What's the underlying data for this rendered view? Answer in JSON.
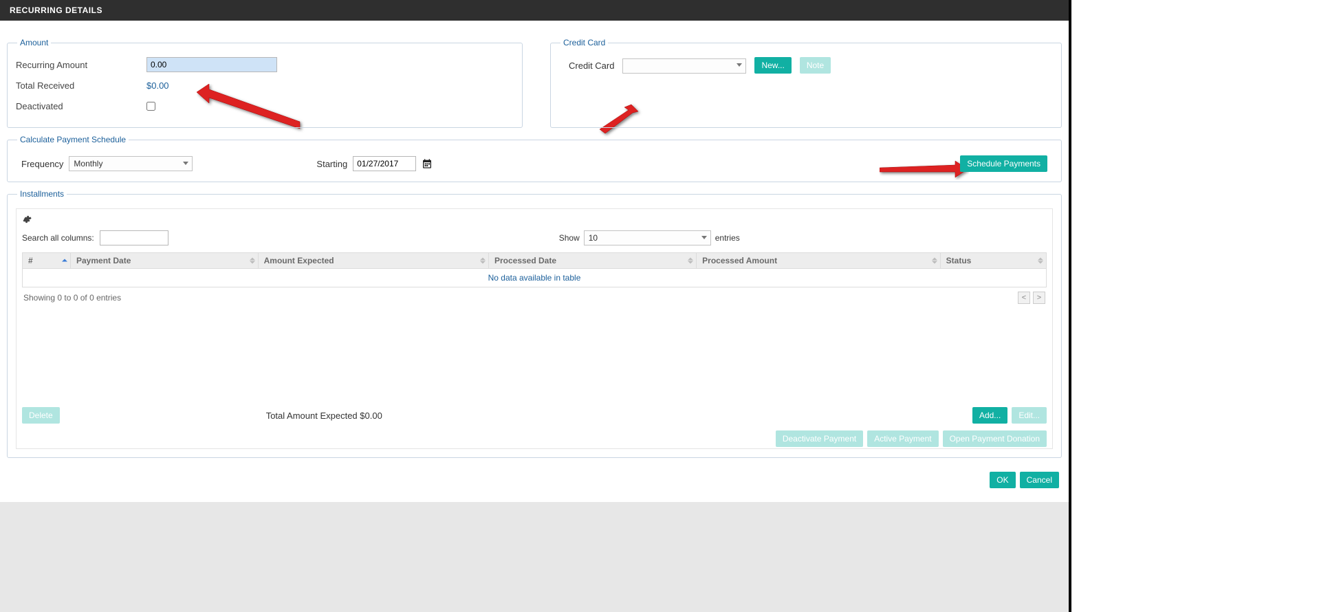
{
  "header": {
    "title": "RECURRING DETAILS"
  },
  "amount_section": {
    "legend": "Amount",
    "recurring_amount_label": "Recurring Amount",
    "recurring_amount_value": "0.00",
    "total_received_label": "Total Received",
    "total_received_value": "$0.00",
    "deactivated_label": "Deactivated",
    "deactivated_checked": false
  },
  "credit_card_section": {
    "legend": "Credit Card",
    "label": "Credit Card",
    "selected": "",
    "new_button": "New...",
    "note_button": "Note"
  },
  "schedule_section": {
    "legend": "Calculate Payment Schedule",
    "frequency_label": "Frequency",
    "frequency_value": "Monthly",
    "starting_label": "Starting",
    "starting_value": "01/27/2017",
    "schedule_button": "Schedule Payments"
  },
  "installments_section": {
    "legend": "Installments",
    "search_label": "Search all columns:",
    "search_value": "",
    "show_label": "Show",
    "show_value": "10",
    "entries_label": "entries",
    "columns": {
      "num": "#",
      "payment_date": "Payment Date",
      "amount_expected": "Amount Expected",
      "processed_date": "Processed Date",
      "processed_amount": "Processed Amount",
      "status": "Status"
    },
    "no_data": "No data available in table",
    "showing_text": "Showing 0 to 0 of 0 entries",
    "pager_prev": "<",
    "pager_next": ">",
    "delete_button": "Delete",
    "total_expected_label": "Total Amount Expected $0.00",
    "add_button": "Add...",
    "edit_button": "Edit...",
    "deactivate_payment_button": "Deactivate Payment",
    "active_payment_button": "Active Payment",
    "open_payment_donation_button": "Open Payment Donation"
  },
  "page_actions": {
    "ok": "OK",
    "cancel": "Cancel"
  }
}
